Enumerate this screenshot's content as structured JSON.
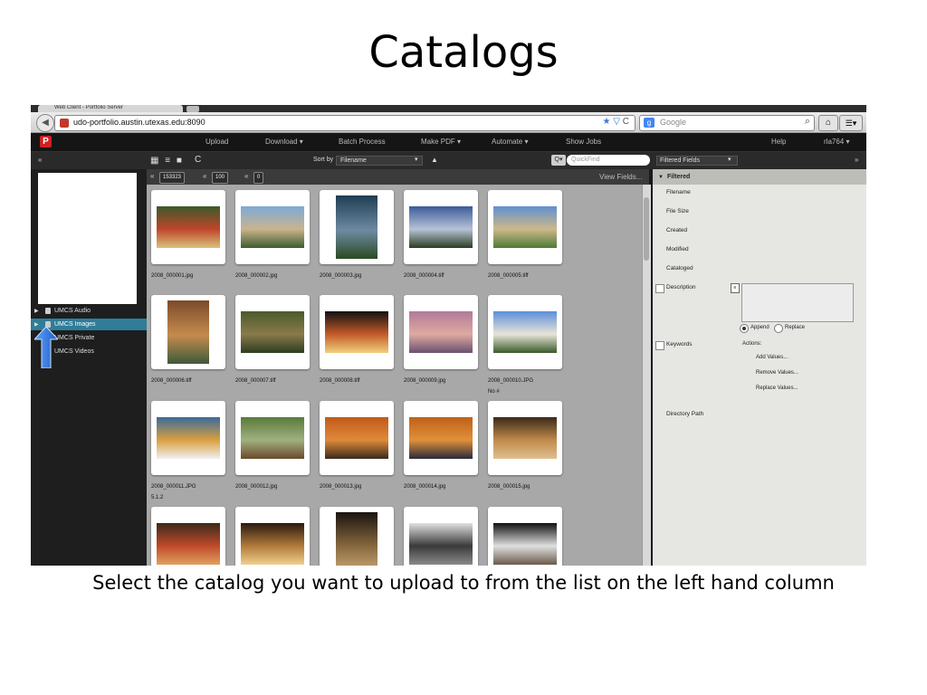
{
  "slide": {
    "title": "Catalogs",
    "caption": "Select the catalog you want to upload to from the list on the left hand column"
  },
  "browser": {
    "tab_title": "Web Client - Portfolio Server",
    "back_icon": "back-arrow-icon",
    "url": "udo-portfolio.austin.utexas.edu:8090",
    "search_placeholder": "Google",
    "icons": [
      "star-icon",
      "reload-icon",
      "search-icon",
      "home-icon",
      "menu-icon"
    ]
  },
  "app": {
    "logo": "P",
    "menu": [
      "Upload",
      "Download ▾",
      "Batch Process",
      "Make PDF ▾",
      "Automate ▾",
      "Show Jobs"
    ],
    "help": "Help",
    "user": "rla764 ▾"
  },
  "toolbar": {
    "collapse_left": "«",
    "collapse_right": "»",
    "view_icons": "▦ ≡ ■",
    "refresh_icon": "C",
    "sort_label": "Sort by",
    "sort_value": "Filename",
    "sort_dropdown": "▾",
    "sort_asc": "▲",
    "quickfind_placeholder": "QuickFind",
    "quickfind_icon": "Q▾",
    "fields_select": "Filtered Fields",
    "fields_dropdown": "▾"
  },
  "grid_bar": {
    "count_total": "153323",
    "per_page": "100",
    "selected": "0",
    "view_fields": "View Fields..."
  },
  "sidebar": {
    "catalogs": [
      {
        "label": "UMCS Audio",
        "arrow": "▶",
        "selected": false
      },
      {
        "label": "UMCS Images",
        "arrow": "▶",
        "selected": true
      },
      {
        "label": "UMCS Private",
        "arrow": "",
        "selected": false
      },
      {
        "label": "UMCS Videos",
        "arrow": "",
        "selected": false
      }
    ]
  },
  "assets": [
    {
      "name": "2008_000001.jpg",
      "extra": "",
      "colors": [
        "#3b5a2a",
        "#c0452b",
        "#d9c27a"
      ]
    },
    {
      "name": "2008_000002.jpg",
      "extra": "",
      "colors": [
        "#7fa9d9",
        "#c9b48c",
        "#3d5b2d"
      ]
    },
    {
      "name": "2008_000003.jpg",
      "extra": "",
      "colors": [
        "#1f3d52",
        "#6d8aa3",
        "#2b4a22"
      ]
    },
    {
      "name": "2008_000004.tiff",
      "extra": "",
      "colors": [
        "#3b5b9a",
        "#b7c2d6",
        "#2a3c22"
      ]
    },
    {
      "name": "2008_000005.tiff",
      "extra": "",
      "colors": [
        "#5f8fcf",
        "#cdb98a",
        "#4c7a33"
      ]
    },
    {
      "name": "2008_000006.tiff",
      "extra": "",
      "colors": [
        "#7b4a2a",
        "#c58b4e",
        "#3d5a3a"
      ]
    },
    {
      "name": "2008_000007.tiff",
      "extra": "",
      "colors": [
        "#4a5a2a",
        "#8a7a4a",
        "#2d3d20"
      ]
    },
    {
      "name": "2008_000008.tiff",
      "extra": "",
      "colors": [
        "#111111",
        "#c45a2a",
        "#f0d07a"
      ]
    },
    {
      "name": "2008_000009.jpg",
      "extra": "",
      "colors": [
        "#b07a9a",
        "#e0a9a0",
        "#6a5070"
      ]
    },
    {
      "name": "2008_000010.JPG",
      "extra": "No #",
      "colors": [
        "#5a8fd9",
        "#e9e4d8",
        "#3a5a2a"
      ]
    },
    {
      "name": "2008_000011.JPG",
      "extra": "5.1.2",
      "colors": [
        "#3a6a9a",
        "#d9a040",
        "#f0f0f0"
      ]
    },
    {
      "name": "2008_000012.jpg",
      "extra": "",
      "colors": [
        "#5a7a3a",
        "#a0b080",
        "#6a4a2a"
      ]
    },
    {
      "name": "2008_000013.jpg",
      "extra": "",
      "colors": [
        "#c05a1a",
        "#e08a3a",
        "#3a2a1a"
      ]
    },
    {
      "name": "2008_000014.jpg",
      "extra": "",
      "colors": [
        "#c0601a",
        "#e0903a",
        "#2a2a3a"
      ]
    },
    {
      "name": "2008_000015.jpg",
      "extra": "",
      "colors": [
        "#3a2a1a",
        "#c08a4a",
        "#e0c090"
      ]
    },
    {
      "name": "",
      "extra": "",
      "colors": [
        "#3a2a1a",
        "#c04a2a",
        "#e0a060"
      ]
    },
    {
      "name": "",
      "extra": "",
      "colors": [
        "#2a1a10",
        "#b07a3a",
        "#f0d090"
      ]
    },
    {
      "name": "",
      "extra": "",
      "colors": [
        "#1a1410",
        "#8a6a40",
        "#d0b080"
      ]
    },
    {
      "name": "",
      "extra": "",
      "colors": [
        "#e0e0e0",
        "#3a3a3a",
        "#8a8a8a"
      ]
    },
    {
      "name": "",
      "extra": "",
      "colors": [
        "#111111",
        "#e0e0e0",
        "#6a5a4a"
      ]
    }
  ],
  "fields_panel": {
    "header": "Filtered",
    "header_arrow": "▼",
    "fields": [
      "Filename",
      "File Size",
      "Created",
      "Modified",
      "Cataloged"
    ],
    "description": "Description",
    "append": "Append",
    "replace": "Replace",
    "keywords": "Keywords",
    "actions_label": "Actions:",
    "actions": [
      "Add Values...",
      "Remove Values...",
      "Replace Values..."
    ],
    "directory_path": "Directory Path"
  }
}
